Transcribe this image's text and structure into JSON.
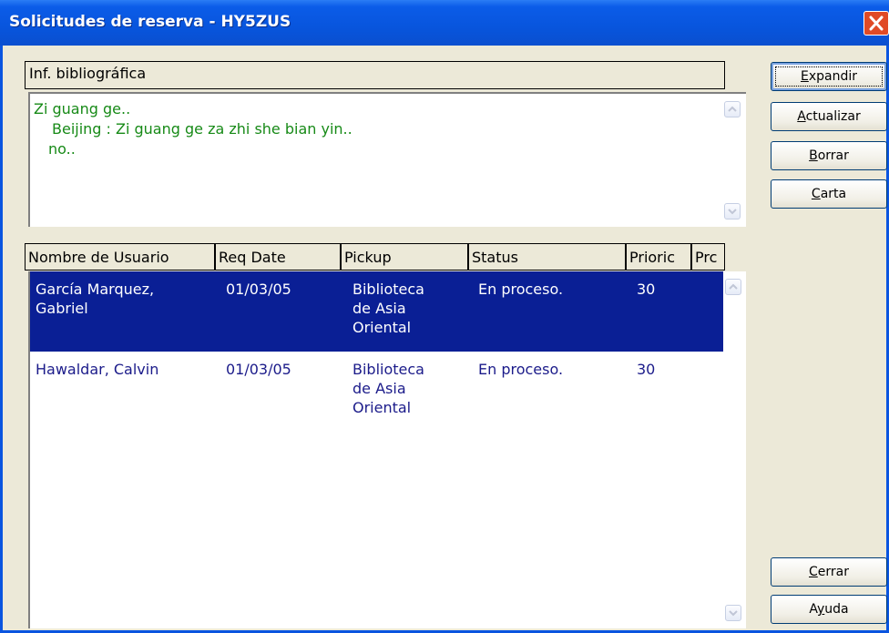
{
  "window": {
    "title": "Solicitudes de reserva - HY5ZUS"
  },
  "biblio": {
    "header": "Inf. bibliográfica",
    "lines": [
      "Zi guang ge..",
      "Beijing : Zi guang ge za zhi she bian yin..",
      "no.."
    ]
  },
  "table": {
    "columns": [
      "Nombre de Usuario",
      "Req Date",
      "Pickup",
      "Status",
      "Prioric",
      "Prc"
    ],
    "rows": [
      {
        "name": [
          "García Marquez,",
          "Gabriel"
        ],
        "date": "01/03/05",
        "pickup": [
          "Biblioteca",
          "de Asia",
          "Oriental"
        ],
        "status": "En proceso.",
        "priority": "30",
        "selected": true
      },
      {
        "name": [
          "Hawaldar, Calvin"
        ],
        "date": "01/03/05",
        "pickup": [
          "Biblioteca",
          "de Asia",
          "Oriental"
        ],
        "status": "En proceso.",
        "priority": "30",
        "selected": false
      }
    ]
  },
  "buttons": {
    "expand": {
      "mnemonic": "E",
      "rest": "xpandir"
    },
    "refresh": {
      "mnemonic": "A",
      "rest": "ctualizar"
    },
    "delete": {
      "mnemonic": "B",
      "rest": "orrar"
    },
    "letter": {
      "mnemonic": "C",
      "rest": "arta"
    },
    "close": {
      "mnemonic": "C",
      "rest": "errar"
    },
    "help": {
      "pre": "A",
      "mnemonic": "y",
      "rest": "uda"
    }
  },
  "colors": {
    "title_bar": "#0855dd",
    "selection": "#0a1f95",
    "biblio_text": "#178a17",
    "row_text": "#1b1b8a"
  }
}
